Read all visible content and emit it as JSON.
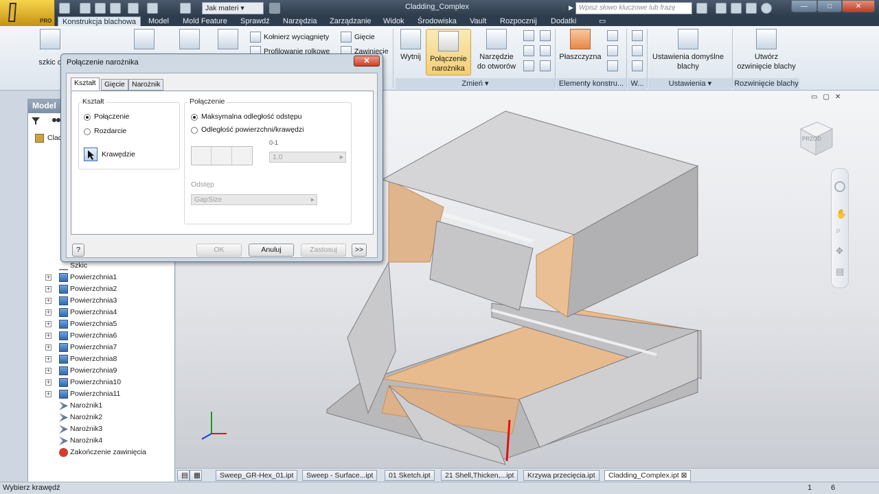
{
  "app": {
    "window_title": "Cladding_Complex",
    "edition_badge": "PRO",
    "material_select": "Jak materi",
    "search_placeholder": "Wpisz słowo kluczowe lub frazę",
    "window_controls": [
      "—",
      "□",
      "✕"
    ]
  },
  "ribbon_tabs": [
    {
      "label": "Konstrukcja blachowa",
      "active": true
    },
    {
      "label": "Model"
    },
    {
      "label": "Mold Feature"
    },
    {
      "label": "Sprawdź"
    },
    {
      "label": "Narzędzia"
    },
    {
      "label": "Zarządzanie"
    },
    {
      "label": "Widok"
    },
    {
      "label": "Środowiska"
    },
    {
      "label": "Vault"
    },
    {
      "label": "Rozpocznij"
    },
    {
      "label": "Dodatki"
    }
  ],
  "ribbon": {
    "sketch_label": "szkic d",
    "flange_label": "Kołnierz wyciągnięty",
    "bend_label": "Gięcie",
    "roll_label": "Profilowanie rolkowe",
    "fold_label": "Zawinięcie",
    "cut_label": "Wytnij",
    "corner_label_1": "Połączenie",
    "corner_label_2": "narożnika",
    "punch_label_1": "Narzędzie",
    "punch_label_2": "do otworów",
    "plane_label": "Płaszczyzna",
    "defaults_label_1": "Ustawienia domyślne",
    "defaults_label_2": "blachy",
    "flat_label_1": "Utwórz",
    "flat_label_2": "ozwinięcie blachy",
    "panels": {
      "modify": "Zmień",
      "work": "Elementy konstru...",
      "w": "W...",
      "settings": "Ustawienia",
      "flat": "Rozwinięcie blachy"
    }
  },
  "browser": {
    "title": "Model",
    "root": "Clad",
    "items": [
      {
        "label": "Szkic",
        "icon": "sketch-icon",
        "plus": false
      },
      {
        "label": "Powierzchnia1",
        "icon": "surface-icon",
        "plus": true
      },
      {
        "label": "Powierzchnia2",
        "icon": "surface-icon",
        "plus": true
      },
      {
        "label": "Powierzchnia3",
        "icon": "surface-icon",
        "plus": true
      },
      {
        "label": "Powierzchnia4",
        "icon": "surface-icon",
        "plus": true
      },
      {
        "label": "Powierzchnia5",
        "icon": "surface-icon",
        "plus": true
      },
      {
        "label": "Powierzchnia6",
        "icon": "surface-icon",
        "plus": true
      },
      {
        "label": "Powierzchnia7",
        "icon": "surface-icon",
        "plus": true
      },
      {
        "label": "Powierzchnia8",
        "icon": "surface-icon",
        "plus": true
      },
      {
        "label": "Powierzchnia9",
        "icon": "surface-icon",
        "plus": true
      },
      {
        "label": "Powierzchnia10",
        "icon": "surface-icon",
        "plus": true
      },
      {
        "label": "Powierzchnia11",
        "icon": "surface-icon",
        "plus": true
      },
      {
        "label": "Narożnik1",
        "icon": "corner-icon",
        "plus": false
      },
      {
        "label": "Narożnik2",
        "icon": "corner-icon",
        "plus": false
      },
      {
        "label": "Narożnik3",
        "icon": "corner-icon",
        "plus": false
      },
      {
        "label": "Narożnik4",
        "icon": "corner-icon",
        "plus": false
      },
      {
        "label": "Zakończenie zawinięcia",
        "icon": "end-of-folded-icon",
        "plus": false
      }
    ]
  },
  "dialog": {
    "title": "Połączenie narożnika",
    "close": "✕",
    "tabs": [
      "Kształt",
      "Gięcie",
      "Narożnik"
    ],
    "shape_group": "Kształt",
    "shape_options": [
      "Połączenie",
      "Rozdarcie"
    ],
    "edges_label": "Krawędzie",
    "connection_group": "Połączenie",
    "connection_options": [
      "Maksymalna odległość odstępu",
      "Odległość powierzchni/krawędzi"
    ],
    "distance_icon_text": "0-1",
    "distance_value": "1,0",
    "gap_label": "Odstęp",
    "gap_value": "GapSize",
    "buttons": {
      "help": "?",
      "ok": "OK",
      "cancel": "Anuluj",
      "apply": "Zastosuj",
      "more": ">>"
    }
  },
  "viewcube": {
    "face": "PRZÓD"
  },
  "doc_tabs": [
    {
      "label": "Sweep_GR-Hex_01.ipt"
    },
    {
      "label": "Sweep - Surface...ipt"
    },
    {
      "label": "01 Sketch.ipt"
    },
    {
      "label": "21 Shell,Thicken,...ipt"
    },
    {
      "label": "Krzywa przecięcia.ipt"
    },
    {
      "label": "Cladding_Complex.ipt",
      "active": true
    }
  ],
  "status": {
    "message": "Wybierz krawędź",
    "count1": "1",
    "count2": "6"
  }
}
